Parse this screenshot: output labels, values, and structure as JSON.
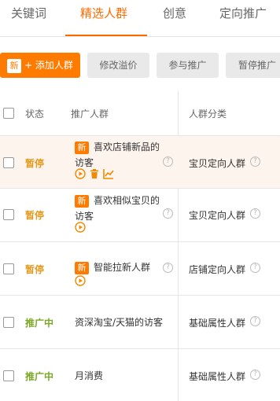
{
  "tabs": [
    {
      "label": "关键词",
      "active": false
    },
    {
      "label": "精选人群",
      "active": true
    },
    {
      "label": "创意",
      "active": false
    },
    {
      "label": "定向推广",
      "active": false
    }
  ],
  "toolbar": {
    "new_badge": "新",
    "add_label": "+ 添加人群",
    "modify_bid": "修改溢价",
    "join_promo": "参与推广",
    "pause_promo": "暂停推广"
  },
  "table": {
    "headers": {
      "status": "状态",
      "group": "推广人群",
      "category": "人群分类"
    },
    "rows": [
      {
        "status": "暂停",
        "status_type": "paused",
        "new": "新",
        "name": "喜欢店铺新品的访客",
        "category": "宝贝定向人群",
        "actions": [
          "play",
          "delete",
          "chart"
        ]
      },
      {
        "status": "暂停",
        "status_type": "paused",
        "new": "新",
        "name": "喜欢相似宝贝的访客",
        "category": "宝贝定向人群",
        "actions": [
          "play"
        ]
      },
      {
        "status": "暂停",
        "status_type": "paused",
        "new": "新",
        "name": "智能拉新人群",
        "category": "店铺定向人群",
        "actions": [
          "play"
        ]
      },
      {
        "status": "推广中",
        "status_type": "active",
        "new": "",
        "name": "资深淘宝/天猫的访客",
        "category": "基础属性人群",
        "actions": []
      },
      {
        "status": "推广中",
        "status_type": "active",
        "new": "",
        "name": "月消费",
        "category": "基础属性人群",
        "actions": []
      }
    ]
  },
  "help_glyph": "?",
  "colors": {
    "accent": "#ff6a00",
    "paused": "#e39a1f",
    "active": "#7aa823",
    "highlight_row": "#fdf4ed"
  }
}
